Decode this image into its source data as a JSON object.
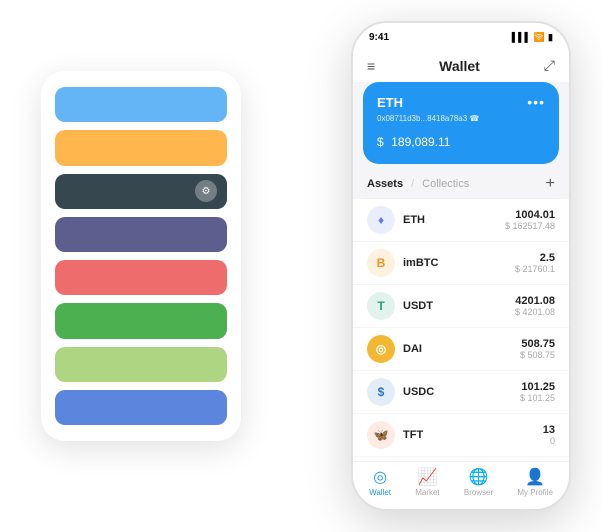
{
  "scene": {
    "bg_card": {
      "strips": [
        {
          "id": "strip-blue",
          "color": "#64B5F6",
          "icon": ""
        },
        {
          "id": "strip-orange",
          "color": "#FFB74D",
          "icon": ""
        },
        {
          "id": "strip-dark",
          "color": "#37474F",
          "icon": "⚙"
        },
        {
          "id": "strip-purple",
          "color": "#5C5E8E",
          "icon": ""
        },
        {
          "id": "strip-red",
          "color": "#EF6C6C",
          "icon": ""
        },
        {
          "id": "strip-green",
          "color": "#4CAF50",
          "icon": ""
        },
        {
          "id": "strip-lime",
          "color": "#AED581",
          "icon": ""
        },
        {
          "id": "strip-royalblue",
          "color": "#5C85DE",
          "icon": ""
        }
      ]
    },
    "phone": {
      "status_bar": {
        "time": "9:41",
        "signal": "▌▌▌",
        "wifi": "WiFi",
        "battery": "🔋"
      },
      "header": {
        "menu_icon": "≡",
        "title": "Wallet",
        "expand_icon": "⤢"
      },
      "eth_card": {
        "label": "ETH",
        "dots": "•••",
        "address": "0x08711d3b...8418a78a3  ☎",
        "currency_symbol": "$",
        "balance": "189,089.11"
      },
      "assets": {
        "tab_active": "Assets",
        "tab_separator": "/",
        "tab_inactive": "Collectics",
        "add_icon": "+"
      },
      "asset_list": [
        {
          "id": "eth",
          "name": "ETH",
          "icon_text": "♦",
          "icon_class": "icon-eth",
          "amount": "1004.01",
          "usd": "$ 162517.48"
        },
        {
          "id": "imbtc",
          "name": "imBTC",
          "icon_text": "B",
          "icon_class": "icon-imbtc",
          "amount": "2.5",
          "usd": "$ 21760.1"
        },
        {
          "id": "usdt",
          "name": "USDT",
          "icon_text": "T",
          "icon_class": "icon-usdt",
          "amount": "4201.08",
          "usd": "$ 4201.08"
        },
        {
          "id": "dai",
          "name": "DAI",
          "icon_text": "◎",
          "icon_class": "icon-dai",
          "amount": "508.75",
          "usd": "$ 508.75"
        },
        {
          "id": "usdc",
          "name": "USDC",
          "icon_text": "$",
          "icon_class": "icon-usdc",
          "amount": "101.25",
          "usd": "$ 101.25"
        },
        {
          "id": "tft",
          "name": "TFT",
          "icon_text": "🦋",
          "icon_class": "icon-tft",
          "amount": "13",
          "usd": "0"
        }
      ],
      "bottom_nav": [
        {
          "id": "wallet",
          "icon": "◎",
          "label": "Wallet",
          "active": true
        },
        {
          "id": "market",
          "icon": "📊",
          "label": "Market",
          "active": false
        },
        {
          "id": "browser",
          "icon": "🌐",
          "label": "Browser",
          "active": false
        },
        {
          "id": "profile",
          "icon": "👤",
          "label": "My Profile",
          "active": false
        }
      ]
    }
  }
}
